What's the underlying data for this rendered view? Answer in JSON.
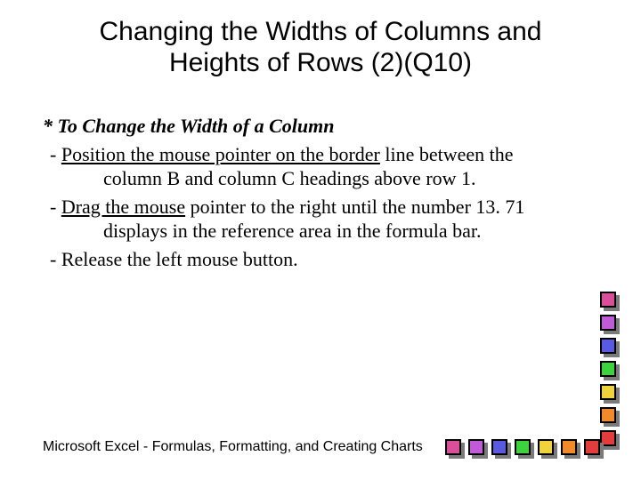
{
  "title": {
    "line1": "Changing the Widths of Columns and",
    "line2": "Heights of Rows (2)(Q10)"
  },
  "body": {
    "star": "* ",
    "subhead": "To Change the Width of a Column",
    "dash": "- ",
    "items": [
      {
        "u": "Position the mouse pointer on the border",
        "rest1": " line between the",
        "rest2": "column B and column C headings above row 1."
      },
      {
        "u": "Drag the mouse",
        "rest1": " pointer to the right until the number 13. 71",
        "rest2": "displays in the reference area in the formula bar."
      },
      {
        "u": "",
        "rest1": "Release the left mouse button.",
        "rest2": ""
      }
    ]
  },
  "footer": "Microsoft  Excel - Formulas, Formatting, and Creating Charts",
  "colors": {
    "v0": "background:#d94f9a",
    "v1": "background:#c05ad6",
    "v2": "background:#5a5ae0",
    "v3": "background:#3fd23f",
    "v4": "background:#f0d23c",
    "v5": "background:#f08a2a",
    "v6": "background:#e23c3c",
    "h0": "background:#d94f9a",
    "h1": "background:#c05ad6",
    "h2": "background:#5a5ae0",
    "h3": "background:#3fd23f",
    "h4": "background:#f0d23c",
    "h5": "background:#f08a2a",
    "h6": "background:#e23c3c"
  }
}
